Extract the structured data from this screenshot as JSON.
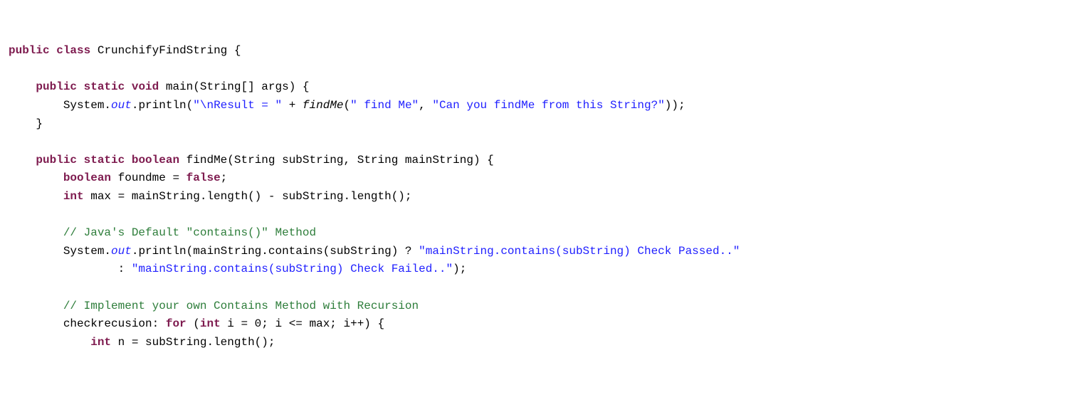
{
  "code": {
    "l01_public": "public",
    "l01_class": "class",
    "l01_name": "CrunchifyFindString",
    "l01_brace": "{",
    "l03_public": "public",
    "l03_static": "static",
    "l03_void": "void",
    "l03_main": "main(String[] args) {",
    "l04_pre": "System.",
    "l04_out": "out",
    "l04_print": ".println(",
    "l04_str1": "\"\\nResult = \"",
    "l04_plus": " + ",
    "l04_findme": "findMe",
    "l04_paren1": "(",
    "l04_str2": "\" find Me\"",
    "l04_comma": ", ",
    "l04_str3": "\"Can you findMe from this String?\"",
    "l04_end": "));",
    "l05_cb": "}",
    "l07_public": "public",
    "l07_static": "static",
    "l07_boolean": "boolean",
    "l07_sig": "findMe(String subString, String mainString) {",
    "l08_boolean": "boolean",
    "l08_rest": " foundme = ",
    "l08_false": "false",
    "l08_semi": ";",
    "l09_int": "int",
    "l09_rest": " max = mainString.length() - subString.length();",
    "l11_comment": "// Java's Default \"contains()\" Method",
    "l12_pre": "System.",
    "l12_out": "out",
    "l12_print": ".println(mainString.contains(subString) ? ",
    "l12_str1": "\"mainString.contains(subString) Check Passed..\"",
    "l13_colon": ": ",
    "l13_str": "\"mainString.contains(subString) Check Failed..\"",
    "l13_end": ");",
    "l15_comment": "// Implement your own Contains Method with Recursion",
    "l16_label": "checkrecusion: ",
    "l16_for": "for",
    "l16_open": " (",
    "l16_int": "int",
    "l16_rest": " i = 0; i <= max; i++) {",
    "l17_int": "int",
    "l17_rest": " n = subString.length();"
  }
}
